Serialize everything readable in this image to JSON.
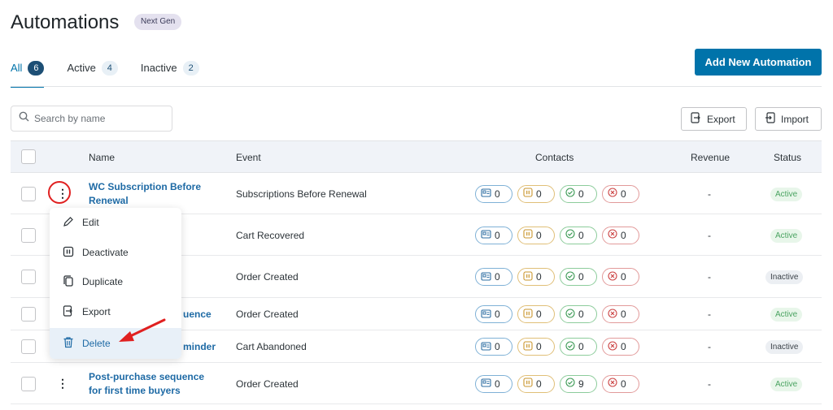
{
  "header": {
    "title": "Automations",
    "badge": "Next Gen"
  },
  "tabs": [
    {
      "label": "All",
      "count": "6"
    },
    {
      "label": "Active",
      "count": "4"
    },
    {
      "label": "Inactive",
      "count": "2"
    }
  ],
  "toolbar": {
    "add_button": "Add New Automation",
    "search_placeholder": "Search by name",
    "export_label": "Export",
    "import_label": "Import"
  },
  "table": {
    "headers": {
      "name": "Name",
      "event": "Event",
      "contacts": "Contacts",
      "revenue": "Revenue",
      "status": "Status"
    },
    "rows": [
      {
        "name_line1": "WC Subscription Before",
        "name_line2": "Renewal",
        "event": "Subscriptions Before Renewal",
        "contacts": [
          "0",
          "0",
          "0",
          "0"
        ],
        "revenue": "-",
        "status": "Active"
      },
      {
        "name_line1": "",
        "name_line2": "",
        "event": "Cart Recovered",
        "contacts": [
          "0",
          "0",
          "0",
          "0"
        ],
        "revenue": "-",
        "status": "Active"
      },
      {
        "name_line1": "",
        "name_line2": "",
        "event": "Order Created",
        "contacts": [
          "0",
          "0",
          "0",
          "0"
        ],
        "revenue": "-",
        "status": "Inactive"
      },
      {
        "name_line1": "uence",
        "name_line2": "",
        "event": "Order Created",
        "contacts": [
          "0",
          "0",
          "0",
          "0"
        ],
        "revenue": "-",
        "status": "Active"
      },
      {
        "name_line1": "minder",
        "name_line2": "",
        "event": "Cart Abandoned",
        "contacts": [
          "0",
          "0",
          "0",
          "0"
        ],
        "revenue": "-",
        "status": "Inactive"
      },
      {
        "name_line1": "Post-purchase sequence",
        "name_line2": "for first time buyers",
        "event": "Order Created",
        "contacts": [
          "0",
          "0",
          "9",
          "0"
        ],
        "revenue": "-",
        "status": "Active"
      }
    ]
  },
  "context_menu": {
    "items": [
      {
        "label": "Edit",
        "icon": "pencil-icon"
      },
      {
        "label": "Deactivate",
        "icon": "pause-icon"
      },
      {
        "label": "Duplicate",
        "icon": "copy-icon"
      },
      {
        "label": "Export",
        "icon": "export-icon"
      },
      {
        "label": "Delete",
        "icon": "trash-icon"
      }
    ]
  },
  "colors": {
    "primary": "#0073aa",
    "link": "#1e6aa5",
    "annotation": "#e02020",
    "active_text": "#4aa361"
  }
}
